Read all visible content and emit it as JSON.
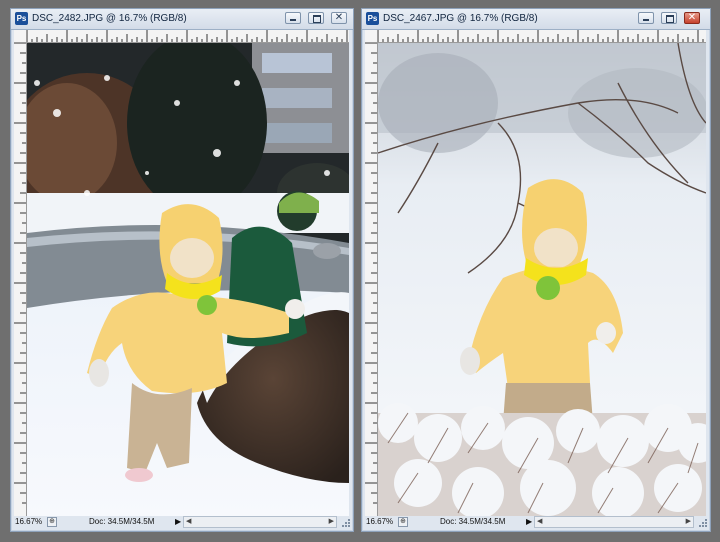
{
  "windows": [
    {
      "title": "DSC_2482.JPG @ 16.7% (RGB/8)",
      "app_icon": "Ps",
      "status": {
        "zoom": "16.67%",
        "doc": "Doc: 34.5M/34.5M"
      },
      "active": false,
      "icons": {
        "app": "photoshop-document-icon",
        "minimize": "minimize-icon",
        "maximize": "maximize-icon",
        "close": "close-icon"
      }
    },
    {
      "title": "DSC_2467.JPG @ 16.7% (RGB/8)",
      "app_icon": "Ps",
      "status": {
        "zoom": "16.67%",
        "doc": "Doc: 34.5M/34.5M"
      },
      "active": true,
      "icons": {
        "app": "photoshop-document-icon",
        "minimize": "minimize-icon",
        "maximize": "maximize-icon",
        "close": "close-icon"
      }
    }
  ],
  "glyphs": {
    "close": "✕",
    "status_arrow": "▶",
    "scroll_left": "◀",
    "scroll_right": "▶",
    "status_icon": "⊕"
  },
  "colors": {
    "chrome": "#dfe6ef",
    "close_active": "#c6412c",
    "workspace": "#6f6f6f"
  }
}
